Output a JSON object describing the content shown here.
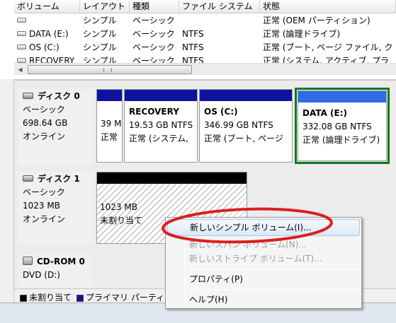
{
  "columns": [
    "ボリューム",
    "レイアウト",
    "種類",
    "ファイル システム",
    "状態"
  ],
  "volumes": [
    {
      "name": "",
      "layout": "シンプル",
      "type": "ベーシック",
      "fs": "",
      "status": "正常 (OEM パーティション)"
    },
    {
      "name": "DATA (E:)",
      "layout": "シンプル",
      "type": "ベーシック",
      "fs": "NTFS",
      "status": "正常 (論理ドライブ)"
    },
    {
      "name": "OS (C:)",
      "layout": "シンプル",
      "type": "ベーシック",
      "fs": "NTFS",
      "status": "正常 (ブート, ページ ファイル, ク"
    },
    {
      "name": "RECOVERY",
      "layout": "シンプル",
      "type": "ベーシック",
      "fs": "NTFS",
      "status": "正常 (システム, アクティブ, プラ"
    }
  ],
  "disk0": {
    "name": "ディスク 0",
    "type": "ベーシック",
    "size": "698.64 GB",
    "state": "オンライン",
    "partitions": [
      {
        "name": "",
        "size": "39 M",
        "status": "正常"
      },
      {
        "name": "RECOVERY",
        "size": "19.53 GB NTFS",
        "status": "正常 (システム,"
      },
      {
        "name": "OS  (C:)",
        "size": "346.99 GB NTFS",
        "status": "正常 (ブート, ページ"
      },
      {
        "name": "DATA  (E:)",
        "size": "332.08 GB NTFS",
        "status": "正常 (論理ドライブ)"
      }
    ]
  },
  "disk1": {
    "name": "ディスク 1",
    "type": "ベーシック",
    "size": "1023 MB",
    "state": "オンライン",
    "unallocated": {
      "size": "1023 MB",
      "status": "未割り当て"
    }
  },
  "cdrom0": {
    "name": "CD-ROM 0",
    "drive": "DVD (D:)"
  },
  "legend": [
    {
      "label": "未割り当て",
      "color": "#000000"
    },
    {
      "label": "プライマリ パーティ",
      "color": "#10129e"
    }
  ],
  "context_menu": {
    "items": [
      {
        "label": "新しいシンプル ボリューム(I)...",
        "enabled": true
      },
      {
        "label": "新しいスパン ボリューム(N)...",
        "enabled": false
      },
      {
        "label": "新しいストライプ ボリューム(T)...",
        "enabled": false
      },
      {
        "label": "プロパティ(P)",
        "enabled": true
      },
      {
        "label": "ヘルプ(H)",
        "enabled": true
      }
    ]
  },
  "colors": {
    "primary_partition": "#10129e",
    "selection_outline": "#0a7a1c",
    "annotation": "#d92020"
  }
}
